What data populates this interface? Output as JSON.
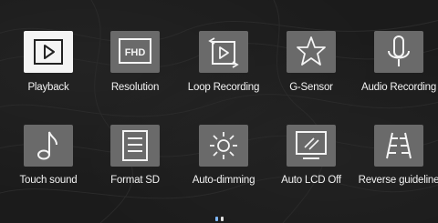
{
  "menu": {
    "items": [
      {
        "label": "Playback",
        "icon": "playback-icon",
        "style": "light"
      },
      {
        "label": "Resolution",
        "icon": "fhd-icon",
        "style": "grey",
        "badge": "FHD"
      },
      {
        "label": "Loop Recording",
        "icon": "loop-recording-icon",
        "style": "grey"
      },
      {
        "label": "G-Sensor",
        "icon": "g-sensor-star-icon",
        "style": "grey"
      },
      {
        "label": "Audio Recording",
        "icon": "microphone-icon",
        "style": "grey"
      },
      {
        "label": "Touch sound",
        "icon": "music-note-icon",
        "style": "grey"
      },
      {
        "label": "Format SD",
        "icon": "format-sd-icon",
        "style": "grey"
      },
      {
        "label": "Auto-dimming",
        "icon": "brightness-icon",
        "style": "grey"
      },
      {
        "label": "Auto LCD Off",
        "icon": "lcd-off-icon",
        "style": "grey"
      },
      {
        "label": "Reverse guideline",
        "icon": "reverse-guideline-icon",
        "style": "grey"
      }
    ]
  },
  "colors": {
    "background": "#1b1b1b",
    "tile_light": "#f4f4f4",
    "tile_grey": "#6a6a6a",
    "icon_stroke_light": "#222222",
    "icon_stroke_grey": "#f4f4f4",
    "label": "#f2f2f2",
    "page_indicator": "#7fb8ff"
  }
}
